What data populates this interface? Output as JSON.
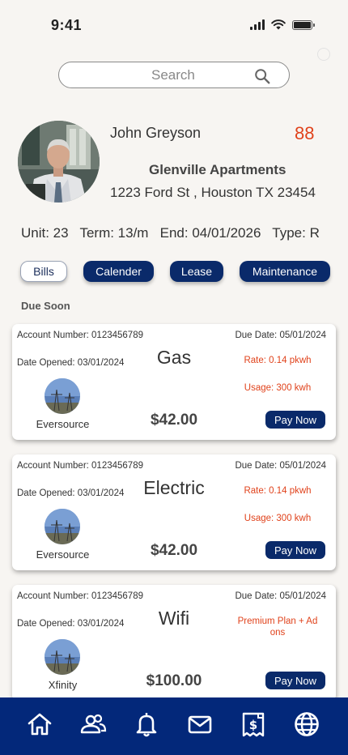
{
  "status_bar": {
    "time": "9:41"
  },
  "search": {
    "placeholder": "Search"
  },
  "profile": {
    "name": "John Greyson",
    "score": "88",
    "property": "Glenville Apartments",
    "address": "1223 Ford St , Houston TX 23454"
  },
  "lease": {
    "summary": "Unit: 23   Term: 13/m   End: 04/01/2026   Type: R"
  },
  "tabs": [
    {
      "label": "Bills",
      "active": true
    },
    {
      "label": "Calender",
      "active": false
    },
    {
      "label": "Lease",
      "active": false
    },
    {
      "label": "Maintenance",
      "active": false
    }
  ],
  "section": {
    "title": "Due Soon"
  },
  "bills": [
    {
      "account": "Account Number: 0123456789",
      "due": "Due Date: 05/01/2024",
      "opened": "Date Opened: 03/01/2024",
      "utility": "Gas",
      "rate": "Rate: 0.14 pkwh",
      "usage": "Usage: 300 kwh",
      "provider": "Eversource",
      "amount": "$42.00",
      "pay_label": "Pay Now"
    },
    {
      "account": "Account Number: 0123456789",
      "due": "Due Date: 05/01/2024",
      "opened": "Date Opened: 03/01/2024",
      "utility": "Electric",
      "rate": "Rate: 0.14 pkwh",
      "usage": "Usage: 300 kwh",
      "provider": "Eversource",
      "amount": "$42.00",
      "pay_label": "Pay Now"
    },
    {
      "account": "Account Number: 0123456789",
      "due": "Due Date: 05/01/2024",
      "opened": "Date Opened: 03/01/2024",
      "utility": "Wifi",
      "rate": "Premium Plan + Ad ons",
      "usage": "",
      "provider": "Xfinity",
      "amount": "$100.00",
      "pay_label": "Pay Now"
    }
  ],
  "nav": [
    {
      "icon": "home-icon"
    },
    {
      "icon": "people-icon"
    },
    {
      "icon": "bell-icon"
    },
    {
      "icon": "mail-icon"
    },
    {
      "icon": "bill-icon"
    },
    {
      "icon": "globe-icon"
    }
  ],
  "colors": {
    "primary": "#0a2a6a",
    "nav_background": "#03287a",
    "accent": "#e0421b",
    "background": "#f7f5f2"
  }
}
